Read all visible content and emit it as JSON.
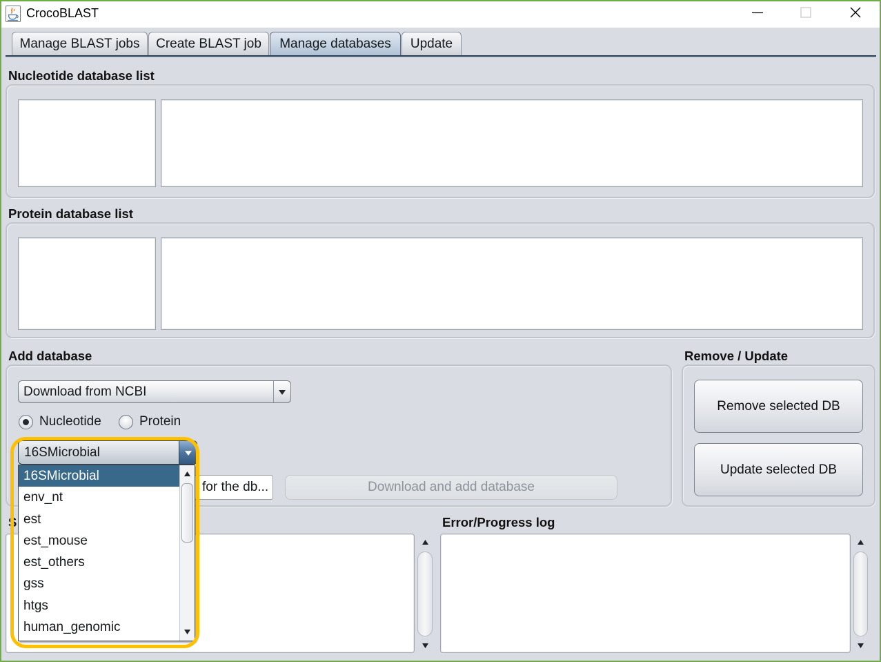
{
  "window": {
    "title": "CrocoBLAST",
    "icons": {
      "app": "java-cup-icon",
      "minimize": "minimize-icon",
      "maximize": "maximize-icon",
      "close": "close-icon"
    },
    "maximize_enabled": false
  },
  "tabs": [
    {
      "label": "Manage BLAST jobs",
      "selected": false
    },
    {
      "label": "Create BLAST job",
      "selected": false
    },
    {
      "label": "Manage databases",
      "selected": true
    },
    {
      "label": "Update",
      "selected": false
    }
  ],
  "nucleotide_databases": {
    "title": "Nucleotide database list"
  },
  "protein_databases": {
    "title": "Protein database list"
  },
  "add_database": {
    "title": "Add database",
    "source": {
      "selected": "Download from NCBI",
      "arrow_icon": "chevron-down-icon"
    },
    "molecule_type": [
      {
        "label": "Nucleotide",
        "checked": true
      },
      {
        "label": "Protein",
        "checked": false
      }
    ],
    "ncbi_database": {
      "selected": "16SMicrobial",
      "expanded": true,
      "options": [
        {
          "label": "16SMicrobial",
          "highlighted": true
        },
        {
          "label": "env_nt",
          "highlighted": false
        },
        {
          "label": "est",
          "highlighted": false
        },
        {
          "label": "est_mouse",
          "highlighted": false
        },
        {
          "label": "est_others",
          "highlighted": false
        },
        {
          "label": "gss",
          "highlighted": false
        },
        {
          "label": "htgs",
          "highlighted": false
        },
        {
          "label": "human_genomic",
          "highlighted": false
        }
      ]
    },
    "name_field": {
      "value": "for the db..."
    },
    "download_button": {
      "label": "Download and add database",
      "enabled": false
    }
  },
  "remove_update": {
    "title": "Remove / Update",
    "remove_button": {
      "label": "Remove selected DB",
      "enabled": true
    },
    "update_button": {
      "label": "Update selected DB",
      "enabled": true
    }
  },
  "status_log": {
    "title": "S"
  },
  "error_log": {
    "title": "Error/Progress log"
  },
  "colors": {
    "panel": "#d9dce2",
    "selection": "#39698a",
    "highlight_ring": "#FFC000",
    "frame": "#70AD47"
  }
}
